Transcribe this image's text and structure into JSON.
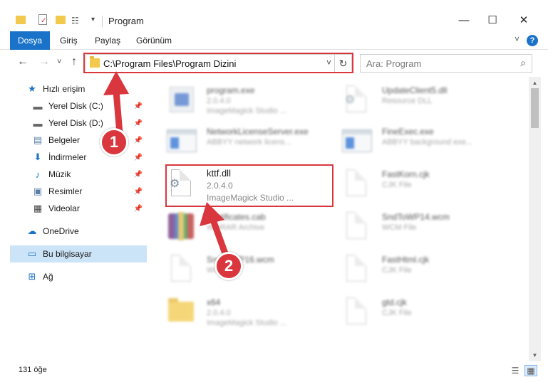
{
  "window": {
    "title": "Program",
    "minimize": "—",
    "maximize": "☐",
    "close": "✕"
  },
  "ribbon": {
    "tabs": [
      "Dosya",
      "Giriş",
      "Paylaş",
      "Görünüm"
    ],
    "expand": "˅",
    "help": "?"
  },
  "navigation": {
    "back": "←",
    "forward": "→",
    "recent": "˅",
    "up": "↑",
    "address": "C:\\Program Files\\Program Dizini",
    "dropdown": "˅",
    "refresh": "↻",
    "search_placeholder": "Ara: Program",
    "search_icon": "⌕"
  },
  "sidebar": {
    "items": [
      {
        "label": "Hızlı erişim",
        "icon": "star-icon",
        "glyph": "★"
      },
      {
        "label": "Yerel Disk (C:)",
        "icon": "drive-icon",
        "glyph": "▬",
        "pinned": true
      },
      {
        "label": "Yerel Disk (D:)",
        "icon": "drive-icon",
        "glyph": "▬",
        "pinned": true
      },
      {
        "label": "Belgeler",
        "icon": "documents-icon",
        "glyph": "▤",
        "pinned": true
      },
      {
        "label": "İndirmeler",
        "icon": "download-icon",
        "glyph": "⬇",
        "pinned": true
      },
      {
        "label": "Müzik",
        "icon": "music-icon",
        "glyph": "♪",
        "pinned": true
      },
      {
        "label": "Resimler",
        "icon": "pictures-icon",
        "glyph": "▣",
        "pinned": true
      },
      {
        "label": "Videolar",
        "icon": "videos-icon",
        "glyph": "▦",
        "pinned": true
      },
      {
        "label": "OneDrive",
        "icon": "cloud-icon",
        "glyph": "☁"
      },
      {
        "label": "Bu bilgisayar",
        "icon": "computer-icon",
        "glyph": "▭",
        "selected": true
      },
      {
        "label": "Ağ",
        "icon": "network-icon",
        "glyph": "⊞"
      }
    ],
    "pin_glyph": "📌"
  },
  "files": [
    {
      "name": "program.exe",
      "meta1": "2.0.4.0",
      "meta2": "ImageMagick Studio ...",
      "icon": "exe",
      "blurred": true
    },
    {
      "name": "UpdateClient5.dll",
      "meta1": "Resource DLL",
      "meta2": "",
      "icon": "dll",
      "blurred": true
    },
    {
      "name": "NetworkLicenseServer.exe",
      "meta1": "ABBYY network licens...",
      "meta2": "",
      "icon": "winapp",
      "blurred": true
    },
    {
      "name": "FineExec.exe",
      "meta1": "ABBYY background exe...",
      "meta2": "",
      "icon": "winapp",
      "blurred": true
    },
    {
      "name": "kttf.dll",
      "meta1": "2.0.4.0",
      "meta2": "ImageMagick Studio ...",
      "icon": "dll",
      "blurred": false
    },
    {
      "name": "FastKorn.cjk",
      "meta1": "CJK File",
      "meta2": "",
      "icon": "doc",
      "blurred": true
    },
    {
      "name": "Certificates.cab",
      "meta1": "WinRAR Archive",
      "meta2": "",
      "icon": "rar",
      "blurred": true
    },
    {
      "name": "SndToWP14.wcm",
      "meta1": "WCM File",
      "meta2": "",
      "icon": "doc",
      "blurred": true
    },
    {
      "name": "SndToWP16.wcm",
      "meta1": "WCM File",
      "meta2": "",
      "icon": "doc",
      "blurred": true
    },
    {
      "name": "FastHtml.cjk",
      "meta1": "CJK File",
      "meta2": "",
      "icon": "doc",
      "blurred": true
    },
    {
      "name": "x64",
      "meta1": "2.0.4.0",
      "meta2": "ImageMagick Studio ...",
      "icon": "folder",
      "blurred": true
    },
    {
      "name": "gtd.cjk",
      "meta1": "CJK File",
      "meta2": "",
      "icon": "doc",
      "blurred": true
    }
  ],
  "status": {
    "count": "131 öğe",
    "details_view": "☰",
    "icons_view": "▦"
  },
  "callouts": {
    "step1": "1",
    "step2": "2"
  },
  "colors": {
    "accent": "#1a73c9",
    "highlight": "#d9363e",
    "selected": "#cce4f7"
  }
}
